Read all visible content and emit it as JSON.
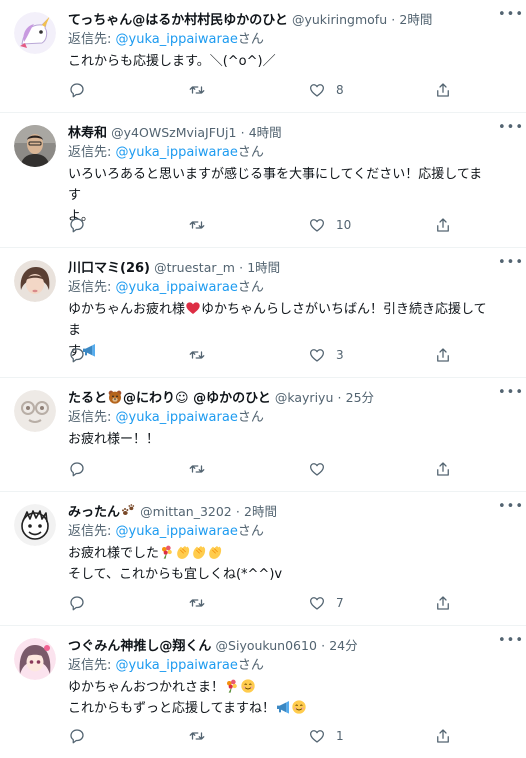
{
  "replies": [
    {
      "name": "てっちゃん@はるか村村民ゆかのひと",
      "handle": "@yukiringmofu",
      "time": "2時間",
      "reply_prefix": "返信先: ",
      "mention": "@yuka_ippaiwarae",
      "reply_suffix": "さん",
      "text": "これからも応援します。＼(^o^)／",
      "like_count": "8",
      "avatar_icon": "unicorn-avatar"
    },
    {
      "name": "林寿和",
      "handle": "@y4OWSzMviaJFUj1",
      "time": "4時間",
      "reply_prefix": "返信先: ",
      "mention": "@yuka_ippaiwarae",
      "reply_suffix": "さん",
      "text": "いろいろあると思いますが感じる事を大事にしてください！応援してます\nよ。",
      "like_count": "10",
      "avatar_icon": "man-photo-avatar"
    },
    {
      "name": "川口マミ(26)",
      "handle": "@truestar_m",
      "time": "1時間",
      "reply_prefix": "返信先: ",
      "mention": "@yuka_ippaiwarae",
      "reply_suffix": "さん",
      "text_a": "ゆかちゃんお疲れ様",
      "text_b": "ゆかちゃんらしさがいちばん！引き続き応援してま",
      "text_c": "す",
      "like_count": "3",
      "avatar_icon": "woman-photo-avatar"
    },
    {
      "name_a": "たると",
      "name_b": "@にわり☺ @ゆかのひと",
      "handle": "@kayriyu",
      "time": "25分",
      "reply_prefix": "返信先: ",
      "mention": "@yuka_ippaiwarae",
      "reply_suffix": "さん",
      "text": "お疲れ様ー！！",
      "like_count": "",
      "avatar_icon": "drawing-avatar"
    },
    {
      "name": "みったん",
      "handle": "@mittan_3202",
      "time": "2時間",
      "reply_prefix": "返信先: ",
      "mention": "@yuka_ippaiwarae",
      "reply_suffix": "さん",
      "text_a": "お疲れ様でした",
      "text_b": "そして、これからも宜しくね(*^^)v",
      "like_count": "7",
      "avatar_icon": "sketch-face-avatar"
    },
    {
      "name": "つぐみん神推し@翔くん",
      "handle": "@Siyoukun0610",
      "time": "24分",
      "reply_prefix": "返信先: ",
      "mention": "@yuka_ippaiwarae",
      "reply_suffix": "さん",
      "text_a": "ゆかちゃんおつかれさま！",
      "text_b": "これからもずっと応援してますね！",
      "like_count": "1",
      "avatar_icon": "anime-girl-avatar"
    }
  ],
  "ui": {
    "separator": "·",
    "more": "•••"
  },
  "colors": {
    "link": "#1d9bf0",
    "secondary": "#536471",
    "text": "#0f1419",
    "divider": "#eff3f4"
  }
}
